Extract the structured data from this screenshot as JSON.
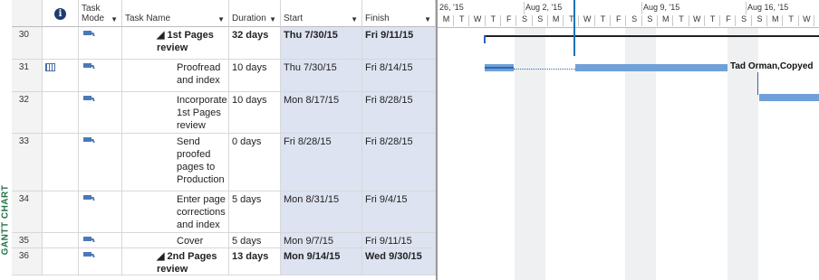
{
  "sidebar": {
    "view_label": "GANTT CHART"
  },
  "columns": {
    "info_icon": "i",
    "task_mode": "Task Mode",
    "task_name": "Task Name",
    "duration": "Duration",
    "start": "Start",
    "finish": "Finish"
  },
  "timeline": {
    "weeks": [
      "26, '15",
      "Aug 2, '15",
      "Aug 9, '15",
      "Aug 16, '15"
    ],
    "days": [
      "M",
      "T",
      "W",
      "T",
      "F",
      "S",
      "S",
      "M",
      "T",
      "W",
      "T",
      "F",
      "S",
      "S",
      "M",
      "T",
      "W",
      "T",
      "F",
      "S",
      "S",
      "M",
      "T",
      "W",
      "T"
    ]
  },
  "tasks": [
    {
      "id": "30",
      "name": "◢ 1st Pages review",
      "duration": "32 days",
      "start": "Thu 7/30/15",
      "finish": "Fri 9/11/15",
      "summary": true
    },
    {
      "id": "31",
      "name": "Proofread and index",
      "duration": "10 days",
      "start": "Thu 7/30/15",
      "finish": "Fri 8/14/15",
      "summary": false,
      "calendar_icon": true
    },
    {
      "id": "32",
      "name": "Incorporate 1st Pages review",
      "duration": "10 days",
      "start": "Mon 8/17/15",
      "finish": "Fri 8/28/15",
      "summary": false
    },
    {
      "id": "33",
      "name": "Send proofed pages to Production",
      "duration": "0 days",
      "start": "Fri 8/28/15",
      "finish": "Fri 8/28/15",
      "summary": false
    },
    {
      "id": "34",
      "name": "Enter page corrections and index",
      "duration": "5 days",
      "start": "Mon 8/31/15",
      "finish": "Fri 9/4/15",
      "summary": false
    },
    {
      "id": "35",
      "name": "Cover design",
      "duration": "5 days",
      "start": "Mon 9/7/15",
      "finish": "Fri 9/11/15",
      "summary": false
    },
    {
      "id": "36",
      "name": "◢ 2nd Pages review",
      "duration": "13 days",
      "start": "Mon 9/14/15",
      "finish": "Wed 9/30/15",
      "summary": true
    }
  ],
  "gantt": {
    "resource_label": "Tad Orman,Copyed"
  },
  "colors": {
    "bar": "#6fa0d8",
    "view_label": "#217346",
    "shade": "#dde3f0"
  },
  "icons": {
    "task_mode": "auto-scheduled-icon",
    "calendar": "calendar-icon",
    "info": "info-icon"
  }
}
